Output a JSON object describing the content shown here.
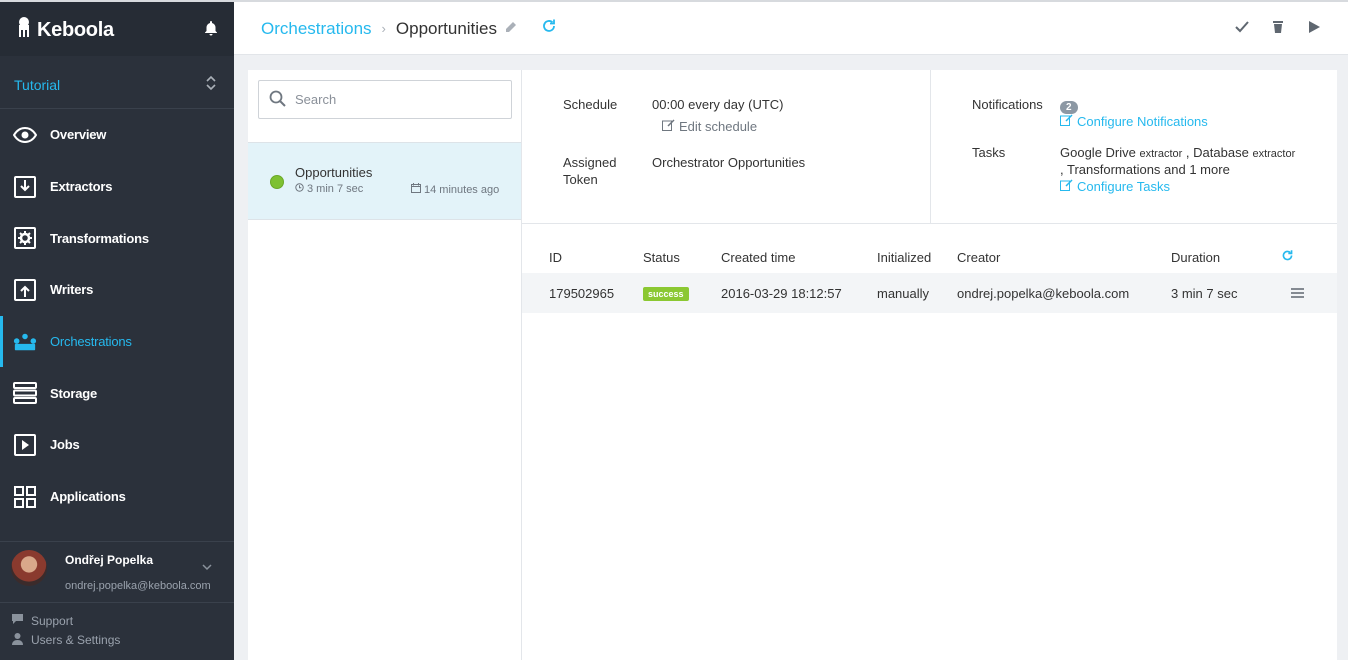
{
  "app": {
    "logo_text": "Keboola"
  },
  "project": {
    "name": "Tutorial"
  },
  "sidebar": {
    "items": [
      {
        "label": "Overview",
        "icon": "eye-icon"
      },
      {
        "label": "Extractors",
        "icon": "download-icon"
      },
      {
        "label": "Transformations",
        "icon": "gear-icon"
      },
      {
        "label": "Writers",
        "icon": "upload-icon"
      },
      {
        "label": "Orchestrations",
        "icon": "orchestration-icon",
        "active": true
      },
      {
        "label": "Storage",
        "icon": "storage-icon"
      },
      {
        "label": "Jobs",
        "icon": "play-icon"
      },
      {
        "label": "Applications",
        "icon": "grid-icon"
      }
    ]
  },
  "user": {
    "name": "Ondřej Popelka",
    "email": "ondrej.popelka@keboola.com"
  },
  "footer": {
    "support": "Support",
    "settings": "Users & Settings"
  },
  "breadcrumb": {
    "parent": "Orchestrations",
    "current": "Opportunities"
  },
  "search": {
    "placeholder": "Search"
  },
  "orchestrations_list": [
    {
      "name": "Opportunities",
      "duration": "3 min 7 sec",
      "last_run": "14 minutes ago",
      "status": "success"
    }
  ],
  "details": {
    "schedule_label": "Schedule",
    "schedule_value": "00:00 every day (UTC)",
    "edit_schedule": "Edit schedule",
    "token_label_1": "Assigned",
    "token_label_2": "Token",
    "token_value": "Orchestrator Opportunities",
    "notifications_label": "Notifications",
    "notifications_count": "2",
    "configure_notifications": "Configure Notifications",
    "tasks_label": "Tasks",
    "task_1": "Google Drive",
    "task_1_type": "extractor",
    "task_2": "Database",
    "task_2_type": "extractor",
    "task_rest": ", Transformations and 1 more",
    "sep": ",",
    "configure_tasks": "Configure Tasks"
  },
  "jobs_table": {
    "headers": [
      "ID",
      "Status",
      "Created time",
      "Initialized",
      "Creator",
      "Duration"
    ],
    "rows": [
      {
        "id": "179502965",
        "status": "success",
        "created": "2016-03-29 18:12:57",
        "initialized": "manually",
        "creator": "ondrej.popelka@keboola.com",
        "duration": "3 min 7 sec"
      }
    ]
  },
  "colors": {
    "accent": "#26b9ee",
    "sidebar_bg": "#2b313b",
    "success": "#8bc832",
    "active_bg": "#e3f3f9"
  }
}
